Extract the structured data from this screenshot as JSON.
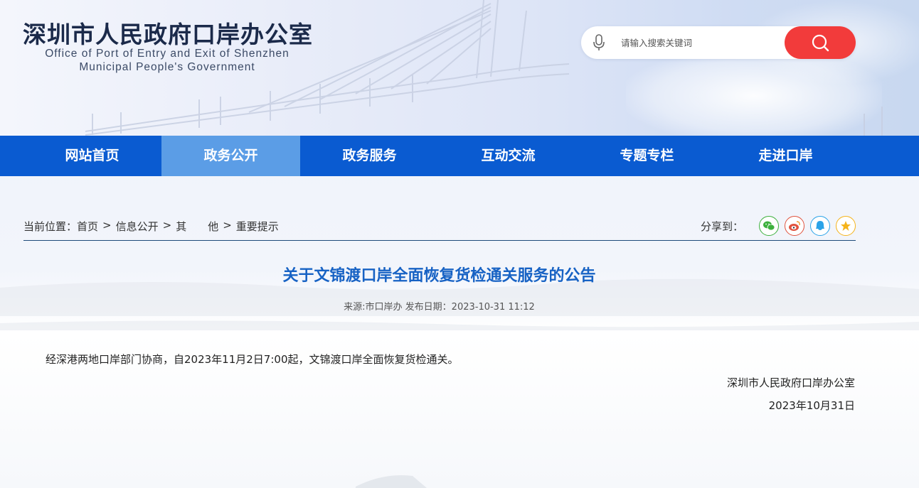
{
  "header": {
    "title": "深圳市人民政府口岸办公室",
    "subtitle_line1": "Office of Port of Entry and Exit of Shenzhen",
    "subtitle_line2": "Municipal People's Government"
  },
  "search": {
    "placeholder": "请输入搜索关键词",
    "mic_icon": "microphone-icon",
    "button_icon": "search-icon",
    "button_color": "#f23b3b"
  },
  "nav": {
    "items": [
      {
        "label": "网站首页"
      },
      {
        "label": "政务公开"
      },
      {
        "label": "政务服务"
      },
      {
        "label": "互动交流"
      },
      {
        "label": "专题专栏"
      },
      {
        "label": "走进口岸"
      }
    ],
    "active_index": 1,
    "bg_color": "#0a5bd1",
    "active_color": "#5b9de6"
  },
  "breadcrumb": {
    "prefix": "当前位置：",
    "items": [
      "首页",
      "信息公开",
      "其　　他",
      "重要提示"
    ],
    "separator": ">"
  },
  "share": {
    "label": "分享到：",
    "icons": [
      "wechat-icon",
      "weibo-icon",
      "qq-icon",
      "qzone-icon"
    ]
  },
  "article": {
    "title": "关于文锦渡口岸全面恢复货检通关服务的公告",
    "meta": "来源:市口岸办 发布日期：2023-10-31 11:12",
    "body": "经深港两地口岸部门协商，自2023年11月2日7:00起，文锦渡口岸全面恢复货检通关。",
    "signature": "深圳市人民政府口岸办公室",
    "date": "2023年10月31日"
  }
}
